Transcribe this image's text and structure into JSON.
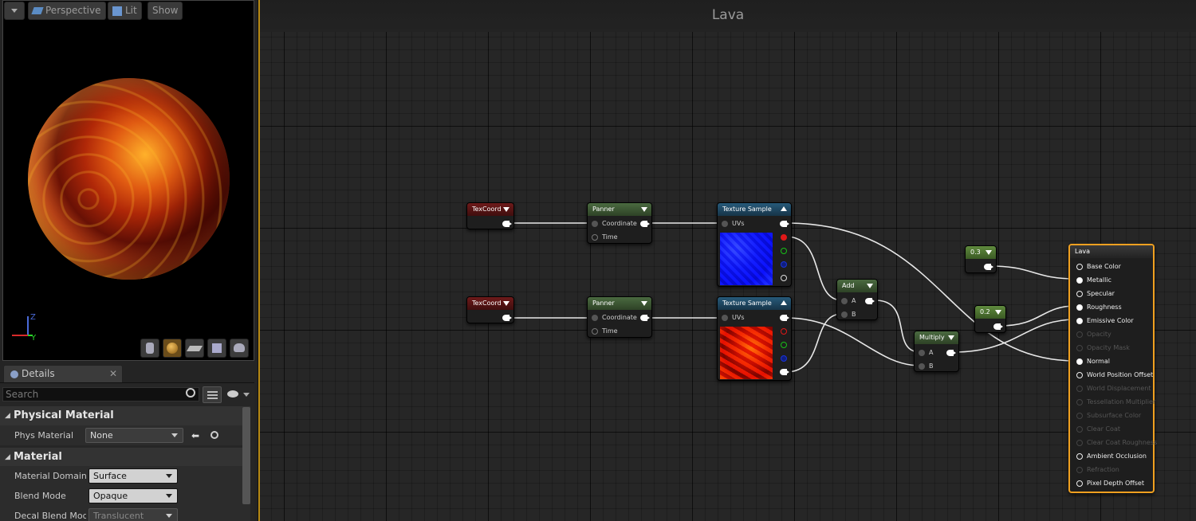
{
  "viewport": {
    "menu_label": "",
    "perspective_label": "Perspective",
    "lit_label": "Lit",
    "show_label": "Show",
    "axis_z": "Z",
    "axis_y": "Y"
  },
  "details": {
    "tab_label": "Details",
    "search_placeholder": "Search",
    "sections": {
      "physical_material": "Physical Material",
      "material": "Material"
    },
    "phys_material_label": "Phys Material",
    "phys_material_value": "None",
    "material_domain_label": "Material Domain",
    "material_domain_value": "Surface",
    "blend_mode_label": "Blend Mode",
    "blend_mode_value": "Opaque",
    "decal_blend_label": "Decal Blend Mode",
    "decal_blend_value": "Translucent"
  },
  "graph": {
    "title": "Lava",
    "nodes": {
      "texcoord1": "TexCoord",
      "texcoord2": "TexCoord",
      "panner1": {
        "title": "Panner",
        "pin_coordinate": "Coordinate",
        "pin_time": "Time"
      },
      "panner2": {
        "title": "Panner",
        "pin_coordinate": "Coordinate",
        "pin_time": "Time"
      },
      "texsample1": {
        "title": "Texture Sample",
        "pin_uvs": "UVs"
      },
      "texsample2": {
        "title": "Texture Sample",
        "pin_uvs": "UVs"
      },
      "add": {
        "title": "Add",
        "pin_a": "A",
        "pin_b": "B"
      },
      "multiply": {
        "title": "Multiply",
        "pin_a": "A",
        "pin_b": "B"
      },
      "const1": "0.3",
      "const2": "0.2",
      "lava": {
        "title": "Lava",
        "inputs": [
          {
            "label": "Base Color",
            "enabled": true
          },
          {
            "label": "Metallic",
            "enabled": true
          },
          {
            "label": "Specular",
            "enabled": true
          },
          {
            "label": "Roughness",
            "enabled": true
          },
          {
            "label": "Emissive Color",
            "enabled": true
          },
          {
            "label": "Opacity",
            "enabled": false
          },
          {
            "label": "Opacity Mask",
            "enabled": false
          },
          {
            "label": "Normal",
            "enabled": true
          },
          {
            "label": "World Position Offset",
            "enabled": true
          },
          {
            "label": "World Displacement",
            "enabled": false
          },
          {
            "label": "Tessellation Multiplier",
            "enabled": false
          },
          {
            "label": "Subsurface Color",
            "enabled": false
          },
          {
            "label": "Clear Coat",
            "enabled": false
          },
          {
            "label": "Clear Coat Roughness",
            "enabled": false
          },
          {
            "label": "Ambient Occlusion",
            "enabled": true
          },
          {
            "label": "Refraction",
            "enabled": false
          },
          {
            "label": "Pixel Depth Offset",
            "enabled": true
          }
        ]
      }
    }
  },
  "colors": {
    "accent": "#f0a020",
    "texcoord_header": "#6e1a1a",
    "panner_header": "#4a6a40",
    "texture_header": "#275a7a"
  }
}
